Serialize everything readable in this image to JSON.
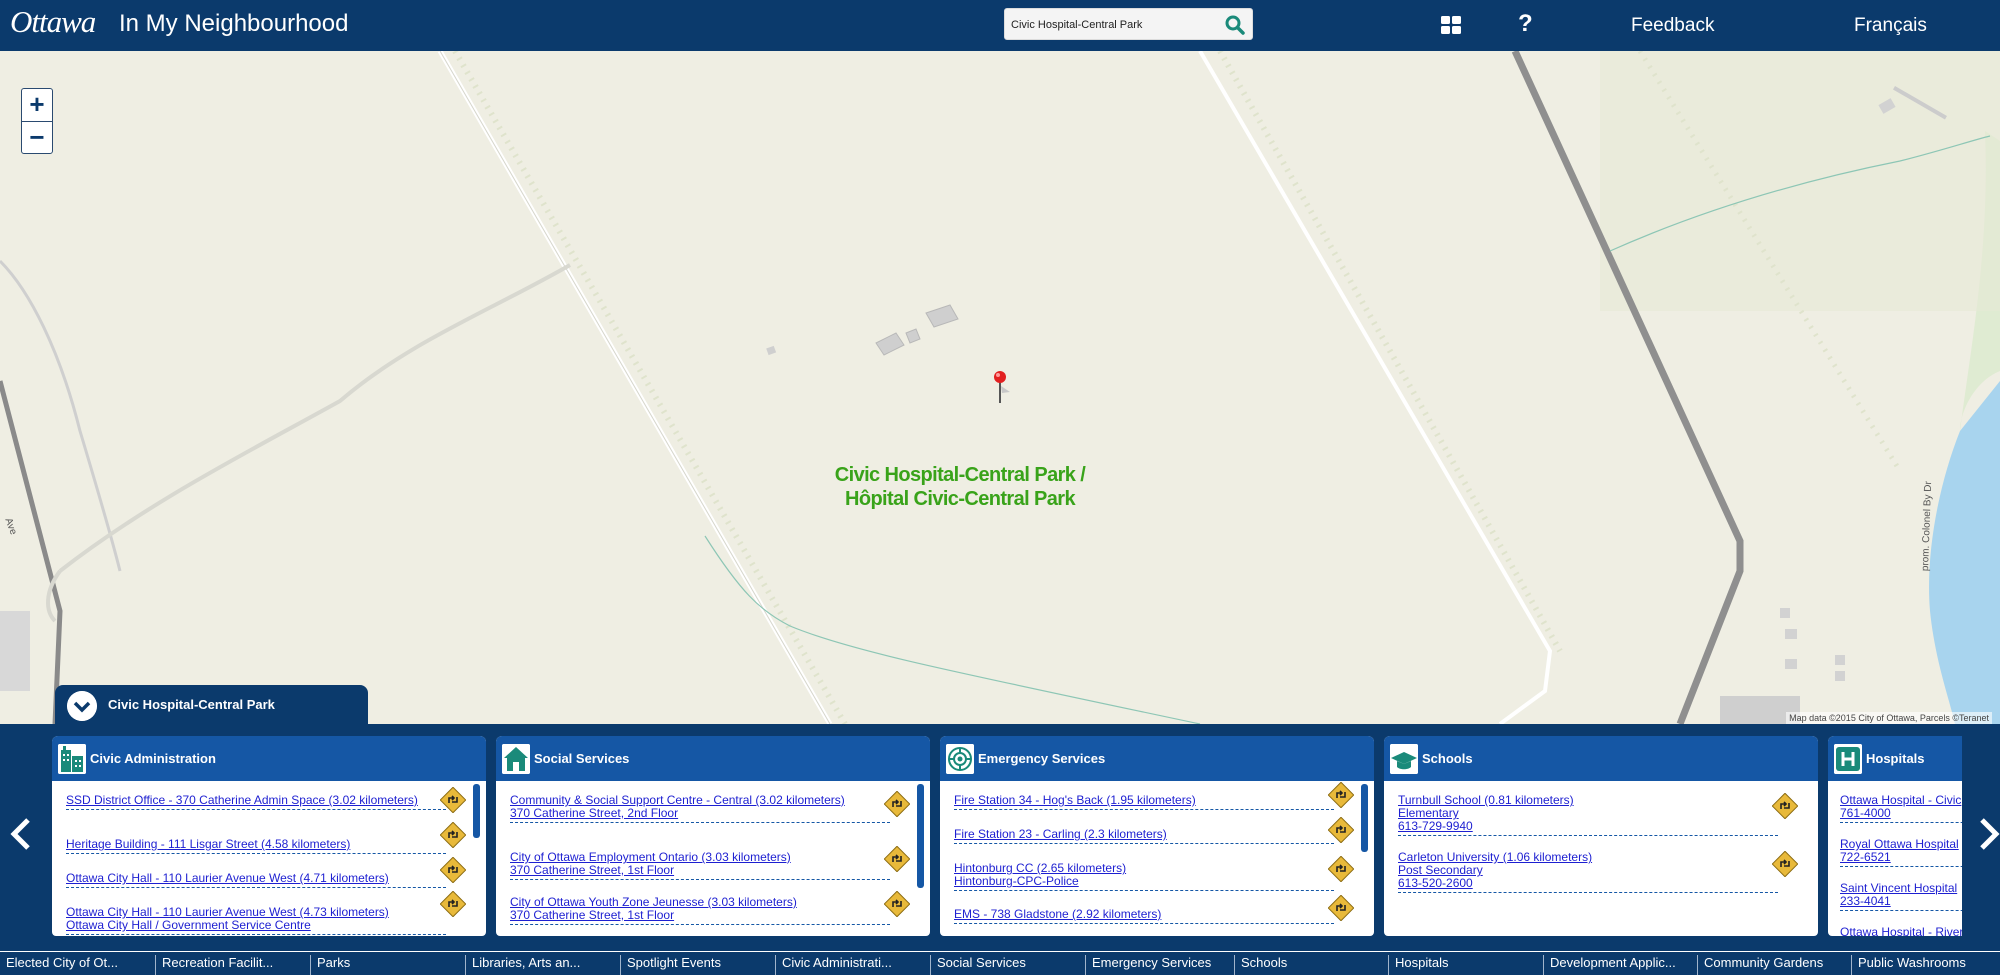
{
  "header": {
    "logo_text": "Ottawa",
    "app_title": "In My Neighbourhood",
    "search_value": "Civic Hospital-Central Park",
    "help_label": "?",
    "feedback_label": "Feedback",
    "language_label": "Français"
  },
  "map": {
    "zoom_in": "+",
    "zoom_out": "−",
    "label_line1": "Civic Hospital-Central Park /",
    "label_line2": "Hôpital Civic-Central Park",
    "attribution": "Map data ©2015 City of Ottawa, Parcels ©Teranet",
    "road_label_left": "Ave",
    "road_label_right": "prom. Colonel By Dr"
  },
  "panel": {
    "title": "Civic Hospital-Central Park"
  },
  "cards": [
    {
      "title": "Civic Administration",
      "icon": "building-icon",
      "items": [
        {
          "link": "SSD District Office - 370 Catherine Admin Space (3.02 kilometers)",
          "sub": ""
        },
        {
          "link": "Heritage Building - 111 Lisgar Street (4.58 kilometers)",
          "sub": ""
        },
        {
          "link": "Ottawa City Hall - 110 Laurier Avenue West (4.71 kilometers)",
          "sub": ""
        },
        {
          "link": "Ottawa City Hall - 110 Laurier Avenue West (4.73 kilometers)",
          "sub": "Ottawa City Hall / Government Service Centre"
        }
      ]
    },
    {
      "title": "Social Services",
      "icon": "house-icon",
      "items": [
        {
          "link": "Community & Social Support Centre - Central (3.02 kilometers)",
          "sub": "370 Catherine Street, 2nd Floor"
        },
        {
          "link": "City of Ottawa Employment Ontario (3.03 kilometers)",
          "sub": "370 Catherine Street, 1st Floor"
        },
        {
          "link": "City of Ottawa Youth Zone Jeunesse (3.03 kilometers)",
          "sub": "370 Catherine Street, 1st Floor"
        }
      ]
    },
    {
      "title": "Emergency Services",
      "icon": "emergency-icon",
      "items": [
        {
          "link": "Fire Station 34 - Hog's Back (1.95 kilometers)",
          "sub": ""
        },
        {
          "link": "Fire Station 23 - Carling (2.3 kilometers)",
          "sub": ""
        },
        {
          "link": "Hintonburg CC (2.65 kilometers)",
          "sub": "Hintonburg-CPC-Police"
        },
        {
          "link": "EMS - 738 Gladstone (2.92 kilometers)",
          "sub": ""
        }
      ]
    },
    {
      "title": "Schools",
      "icon": "graduation-cap-icon",
      "items": [
        {
          "link": "Turnbull School (0.81 kilometers)",
          "sub": "Elementary",
          "sub2": "613-729-9940"
        },
        {
          "link": "Carleton University (1.06 kilometers)",
          "sub": "Post Secondary",
          "sub2": "613-520-2600"
        }
      ]
    },
    {
      "title": "Hospitals",
      "icon": "hospital-icon",
      "items": [
        {
          "link": "Ottawa Hospital - Civic",
          "sub": "761-4000"
        },
        {
          "link": "Royal Ottawa Hospital",
          "sub": "722-6521"
        },
        {
          "link": "Saint Vincent Hospital",
          "sub": "233-4041"
        },
        {
          "link": "Ottawa Hospital - Riverside",
          "sub": ""
        }
      ]
    }
  ],
  "bottom_tabs": [
    "Elected City of Ot...",
    "Recreation Facilit...",
    "Parks",
    "Libraries, Arts an...",
    "Spotlight Events",
    "Civic Administrati...",
    "Social Services",
    "Emergency Services",
    "Schools",
    "Hospitals",
    "Development Applic...",
    "Community Gardens",
    "Public Washrooms"
  ],
  "colors": {
    "header_bg": "#0b3a6c",
    "card_head": "#1557a5",
    "map_label": "#39a31a",
    "link": "#1d1fd1",
    "map_bg": "#efeee3"
  }
}
